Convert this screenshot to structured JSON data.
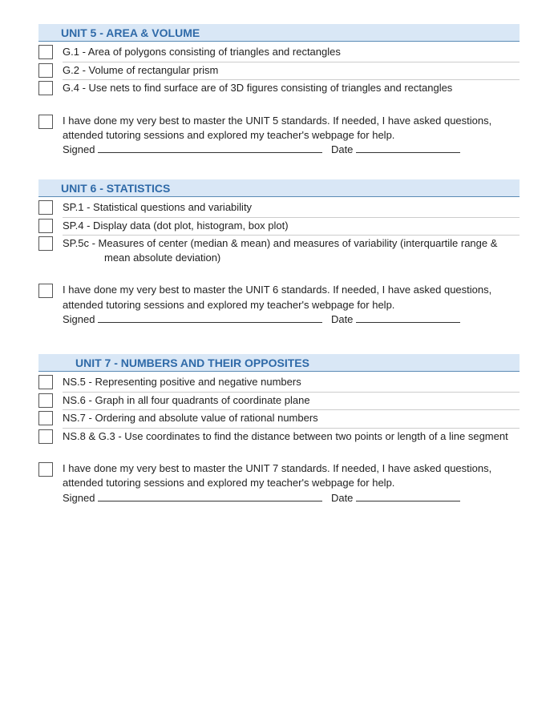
{
  "units": [
    {
      "title": "UNIT 5 - AREA & VOLUME",
      "items": [
        "G.1 - Area of polygons consisting of triangles and rectangles",
        "G.2 - Volume of rectangular prism",
        "G.4 - Use nets to find surface are of 3D figures consisting of triangles and rectangles"
      ],
      "pledge": "I have done my very best to master the UNIT 5 standards. If needed, I have asked questions, attended tutoring sessions and explored my teacher's webpage for help.",
      "signed_label": "Signed",
      "date_label": "Date"
    },
    {
      "title": "UNIT 6 - STATISTICS",
      "items": [
        "SP.1 - Statistical questions and variability",
        "SP.4 - Display data (dot plot, histogram, box plot)",
        "SP.5c - Measures of center (median & mean) and measures of variability (interquartile range & mean absolute deviation)"
      ],
      "pledge": "I have done my very best to master the UNIT 6 standards. If needed, I have asked questions, attended tutoring sessions and explored my teacher's webpage for help.",
      "signed_label": "Signed",
      "date_label": "Date"
    },
    {
      "title": "UNIT 7 - NUMBERS AND THEIR OPPOSITES",
      "items": [
        "NS.5 - Representing positive and negative numbers",
        "NS.6 - Graph in all four quadrants of coordinate plane",
        "NS.7 - Ordering and absolute value of rational numbers",
        "NS.8 & G.3 - Use coordinates to find the distance between two points or length of a line segment"
      ],
      "pledge": "I have done my very best to master the UNIT 7 standards. If needed, I have asked questions, attended tutoring sessions and explored my teacher's webpage for help.",
      "signed_label": "Signed",
      "date_label": "Date"
    }
  ]
}
